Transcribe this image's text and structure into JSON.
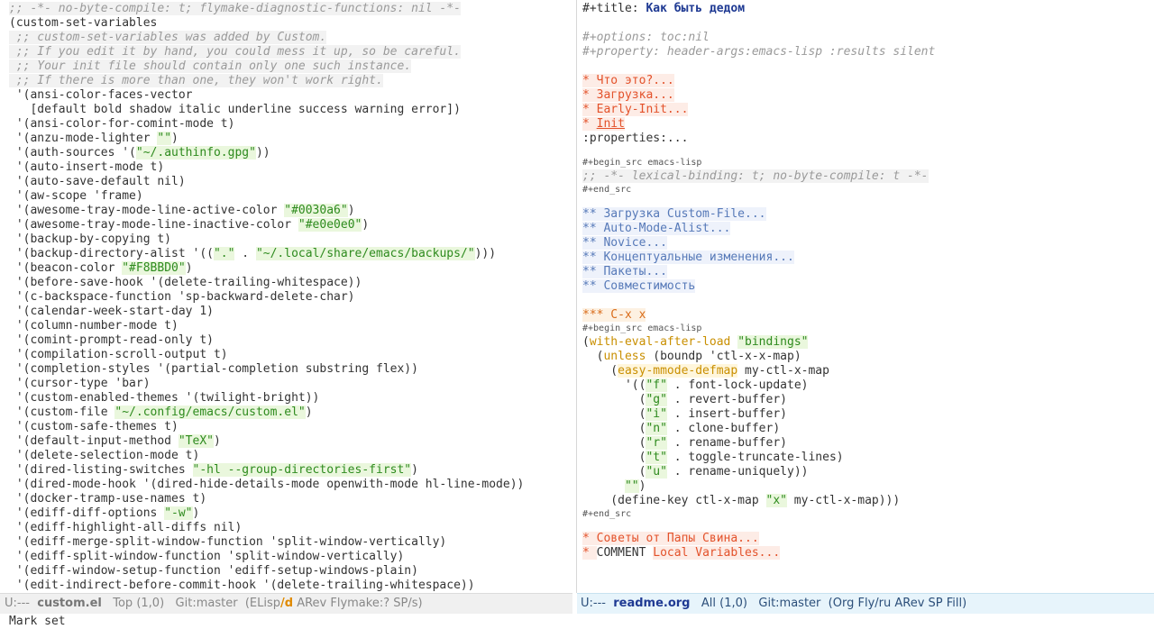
{
  "colors": {
    "comment": "#9a9a9a",
    "string": "#2e8b1e",
    "keyword": "#c98f00",
    "heading1": "#e3522b",
    "heading2": "#5679b8",
    "heading3": "#d96c1a",
    "title": "#1f3a93",
    "modeline_active_bg": "#e7f4fb"
  },
  "left_buffer": {
    "lines": [
      [
        {
          "t": ";; -*- no-byte-compile: t; flymake-diagnostic-functions: nil -*-",
          "c": "cmt"
        }
      ],
      [
        {
          "t": "(custom-set-variables",
          "c": ""
        }
      ],
      [
        {
          "t": " ;; custom-set-variables was added by Custom.",
          "c": "cmt"
        }
      ],
      [
        {
          "t": " ;; If you edit it by hand, you could mess it up, so be careful.",
          "c": "cmt"
        }
      ],
      [
        {
          "t": " ;; Your init file should contain only one such instance.",
          "c": "cmt"
        }
      ],
      [
        {
          "t": " ;; If there is more than one, they won't work right.",
          "c": "cmt"
        }
      ],
      [
        {
          "t": " '(ansi-color-faces-vector",
          "c": ""
        }
      ],
      [
        {
          "t": "   [default bold shadow italic underline success warning error])",
          "c": ""
        }
      ],
      [
        {
          "t": " '(ansi-color-for-comint-mode t)",
          "c": ""
        }
      ],
      [
        {
          "t": " '(anzu-mode-lighter ",
          "c": ""
        },
        {
          "t": "\"\"",
          "c": "str"
        },
        {
          "t": ")",
          "c": ""
        }
      ],
      [
        {
          "t": " '(auth-sources '(",
          "c": ""
        },
        {
          "t": "\"~/.authinfo.gpg\"",
          "c": "str"
        },
        {
          "t": "))",
          "c": ""
        }
      ],
      [
        {
          "t": " '(auto-insert-mode t)",
          "c": ""
        }
      ],
      [
        {
          "t": " '(auto-save-default nil)",
          "c": ""
        }
      ],
      [
        {
          "t": " '(aw-scope 'frame)",
          "c": ""
        }
      ],
      [
        {
          "t": " '(awesome-tray-mode-line-active-color ",
          "c": ""
        },
        {
          "t": "\"#0030a6\"",
          "c": "str"
        },
        {
          "t": ")",
          "c": ""
        }
      ],
      [
        {
          "t": " '(awesome-tray-mode-line-inactive-color ",
          "c": ""
        },
        {
          "t": "\"#e0e0e0\"",
          "c": "str"
        },
        {
          "t": ")",
          "c": ""
        }
      ],
      [
        {
          "t": " '(backup-by-copying t)",
          "c": ""
        }
      ],
      [
        {
          "t": " '(backup-directory-alist '((",
          "c": ""
        },
        {
          "t": "\".\"",
          "c": "str"
        },
        {
          "t": " . ",
          "c": ""
        },
        {
          "t": "\"~/.local/share/emacs/backups/\"",
          "c": "str"
        },
        {
          "t": ")))",
          "c": ""
        }
      ],
      [
        {
          "t": " '(beacon-color ",
          "c": ""
        },
        {
          "t": "\"#F8BBD0\"",
          "c": "str"
        },
        {
          "t": ")",
          "c": ""
        }
      ],
      [
        {
          "t": " '(before-save-hook '(delete-trailing-whitespace))",
          "c": ""
        }
      ],
      [
        {
          "t": " '(c-backspace-function 'sp-backward-delete-char)",
          "c": ""
        }
      ],
      [
        {
          "t": " '(calendar-week-start-day 1)",
          "c": ""
        }
      ],
      [
        {
          "t": " '(column-number-mode t)",
          "c": ""
        }
      ],
      [
        {
          "t": " '(comint-prompt-read-only t)",
          "c": ""
        }
      ],
      [
        {
          "t": " '(compilation-scroll-output t)",
          "c": ""
        }
      ],
      [
        {
          "t": " '(completion-styles '(partial-completion substring flex))",
          "c": ""
        }
      ],
      [
        {
          "t": " '(cursor-type 'bar)",
          "c": ""
        }
      ],
      [
        {
          "t": " '(custom-enabled-themes '(twilight-bright))",
          "c": ""
        }
      ],
      [
        {
          "t": " '(custom-file ",
          "c": ""
        },
        {
          "t": "\"~/.config/emacs/custom.el\"",
          "c": "str"
        },
        {
          "t": ")",
          "c": ""
        }
      ],
      [
        {
          "t": " '(custom-safe-themes t)",
          "c": ""
        }
      ],
      [
        {
          "t": " '(default-input-method ",
          "c": ""
        },
        {
          "t": "\"TeX\"",
          "c": "str"
        },
        {
          "t": ")",
          "c": ""
        }
      ],
      [
        {
          "t": " '(delete-selection-mode t)",
          "c": ""
        }
      ],
      [
        {
          "t": " '(dired-listing-switches ",
          "c": ""
        },
        {
          "t": "\"-hl --group-directories-first\"",
          "c": "str"
        },
        {
          "t": ")",
          "c": ""
        }
      ],
      [
        {
          "t": " '(dired-mode-hook '(dired-hide-details-mode openwith-mode hl-line-mode))",
          "c": ""
        }
      ],
      [
        {
          "t": " '(docker-tramp-use-names t)",
          "c": ""
        }
      ],
      [
        {
          "t": " '(ediff-diff-options ",
          "c": ""
        },
        {
          "t": "\"-w\"",
          "c": "str"
        },
        {
          "t": ")",
          "c": ""
        }
      ],
      [
        {
          "t": " '(ediff-highlight-all-diffs nil)",
          "c": ""
        }
      ],
      [
        {
          "t": " '(ediff-merge-split-window-function 'split-window-vertically)",
          "c": ""
        }
      ],
      [
        {
          "t": " '(ediff-split-window-function 'split-window-vertically)",
          "c": ""
        }
      ],
      [
        {
          "t": " '(ediff-window-setup-function 'ediff-setup-windows-plain)",
          "c": ""
        }
      ],
      [
        {
          "t": " '(edit-indirect-before-commit-hook '(delete-trailing-whitespace))",
          "c": ""
        }
      ]
    ]
  },
  "right_buffer": {
    "lines": [
      {
        "k": "n",
        "s": [
          {
            "t": "#+title: ",
            "c": ""
          },
          {
            "t": "Как быть дедом",
            "c": "ttl"
          }
        ]
      },
      {
        "k": "gap",
        "s": []
      },
      {
        "k": "n",
        "s": [
          {
            "t": "#+options: toc:nil",
            "c": "cmt2"
          }
        ]
      },
      {
        "k": "n",
        "s": [
          {
            "t": "#+property: header-args:emacs-lisp :results silent",
            "c": "cmt2"
          }
        ]
      },
      {
        "k": "gap",
        "s": []
      },
      {
        "k": "n",
        "s": [
          {
            "t": "* Что это?...",
            "c": "h1"
          }
        ]
      },
      {
        "k": "n",
        "s": [
          {
            "t": "* Загрузка...",
            "c": "h1"
          }
        ]
      },
      {
        "k": "n",
        "s": [
          {
            "t": "* Early-Init...",
            "c": "h1"
          }
        ]
      },
      {
        "k": "n",
        "s": [
          {
            "t": "* ",
            "c": "h1"
          },
          {
            "t": "Init",
            "c": "h1u"
          }
        ]
      },
      {
        "k": "n",
        "s": [
          {
            "t": ":properties:...",
            "c": ""
          }
        ]
      },
      {
        "k": "gapsm",
        "s": []
      },
      {
        "k": "small",
        "s": [
          {
            "t": "#+begin_src emacs-lisp",
            "c": ""
          }
        ]
      },
      {
        "k": "n",
        "s": [
          {
            "t": ";; -*- lexical-binding: t; no-byte-compile: t -*-",
            "c": "cmt"
          }
        ]
      },
      {
        "k": "small",
        "s": [
          {
            "t": "#+end_src",
            "c": ""
          }
        ]
      },
      {
        "k": "gapsm",
        "s": []
      },
      {
        "k": "n",
        "s": [
          {
            "t": "** Загрузка Custom-File...",
            "c": "h2"
          }
        ]
      },
      {
        "k": "n",
        "s": [
          {
            "t": "** Auto-Mode-Alist...",
            "c": "h2"
          }
        ]
      },
      {
        "k": "n",
        "s": [
          {
            "t": "** Novice...",
            "c": "h2"
          }
        ]
      },
      {
        "k": "n",
        "s": [
          {
            "t": "** Концептуальные изменения...",
            "c": "h2"
          }
        ]
      },
      {
        "k": "n",
        "s": [
          {
            "t": "** Пакеты...",
            "c": "h2"
          }
        ]
      },
      {
        "k": "n",
        "s": [
          {
            "t": "** Совместимость",
            "c": "h2"
          }
        ]
      },
      {
        "k": "gap",
        "s": []
      },
      {
        "k": "n",
        "s": [
          {
            "t": "*** C-x x",
            "c": "h3"
          }
        ]
      },
      {
        "k": "small",
        "s": [
          {
            "t": "#+begin_src emacs-lisp",
            "c": ""
          }
        ]
      },
      {
        "k": "n",
        "s": [
          {
            "t": "(",
            "c": ""
          },
          {
            "t": "with-eval-after-load",
            "c": "kw"
          },
          {
            "t": " ",
            "c": ""
          },
          {
            "t": "\"bindings\"",
            "c": "str"
          }
        ]
      },
      {
        "k": "n",
        "s": [
          {
            "t": "  (",
            "c": ""
          },
          {
            "t": "unless",
            "c": "kw"
          },
          {
            "t": " (boundp 'ctl-x-x-map)",
            "c": ""
          }
        ]
      },
      {
        "k": "n",
        "s": [
          {
            "t": "    (",
            "c": ""
          },
          {
            "t": "easy-mmode-defmap",
            "c": "kw2"
          },
          {
            "t": " my-ctl-x-map",
            "c": ""
          }
        ]
      },
      {
        "k": "n",
        "s": [
          {
            "t": "      '((",
            "c": ""
          },
          {
            "t": "\"f\"",
            "c": "str"
          },
          {
            "t": " . font-lock-update)",
            "c": ""
          }
        ]
      },
      {
        "k": "n",
        "s": [
          {
            "t": "        (",
            "c": ""
          },
          {
            "t": "\"g\"",
            "c": "str"
          },
          {
            "t": " . revert-buffer)",
            "c": ""
          }
        ]
      },
      {
        "k": "n",
        "s": [
          {
            "t": "        (",
            "c": ""
          },
          {
            "t": "\"i\"",
            "c": "str"
          },
          {
            "t": " . insert-buffer)",
            "c": ""
          }
        ]
      },
      {
        "k": "n",
        "s": [
          {
            "t": "        (",
            "c": ""
          },
          {
            "t": "\"n\"",
            "c": "str"
          },
          {
            "t": " . clone-buffer)",
            "c": ""
          }
        ]
      },
      {
        "k": "n",
        "s": [
          {
            "t": "        (",
            "c": ""
          },
          {
            "t": "\"r\"",
            "c": "str"
          },
          {
            "t": " . rename-buffer)",
            "c": ""
          }
        ]
      },
      {
        "k": "n",
        "s": [
          {
            "t": "        (",
            "c": ""
          },
          {
            "t": "\"t\"",
            "c": "str"
          },
          {
            "t": " . toggle-truncate-lines)",
            "c": ""
          }
        ]
      },
      {
        "k": "n",
        "s": [
          {
            "t": "        (",
            "c": ""
          },
          {
            "t": "\"u\"",
            "c": "str"
          },
          {
            "t": " . rename-uniquely))",
            "c": ""
          }
        ]
      },
      {
        "k": "n",
        "s": [
          {
            "t": "      ",
            "c": ""
          },
          {
            "t": "\"\"",
            "c": "str"
          },
          {
            "t": ")",
            "c": ""
          }
        ]
      },
      {
        "k": "n",
        "s": [
          {
            "t": "    (define-key ctl-x-map ",
            "c": ""
          },
          {
            "t": "\"x\"",
            "c": "str"
          },
          {
            "t": " my-ctl-x-map)))",
            "c": ""
          }
        ]
      },
      {
        "k": "small",
        "s": [
          {
            "t": "#+end_src",
            "c": ""
          }
        ]
      },
      {
        "k": "gapsm",
        "s": []
      },
      {
        "k": "n",
        "s": [
          {
            "t": "* Советы от Папы Свина...",
            "c": "h1"
          }
        ]
      },
      {
        "k": "n",
        "s": [
          {
            "t": "* ",
            "c": "h1"
          },
          {
            "t": "COMMENT ",
            "c": ""
          },
          {
            "t": "Local Variables...",
            "c": "h1"
          }
        ]
      }
    ]
  },
  "modeline_left": {
    "status": "U:---",
    "buffer_name": "custom.el",
    "position": "Top (1,0)",
    "vcs": "Git:master",
    "modes_before": "(ELisp",
    "modes_accent": "/d",
    "modes_after": " ARev Flymake:? SP/s)"
  },
  "modeline_right": {
    "status": "U:---",
    "buffer_name": "readme.org",
    "position": "All (1,0)",
    "vcs": "Git:master",
    "modes": "(Org Fly/ru ARev SP Fill)"
  },
  "minibuffer": {
    "message": "Mark set"
  }
}
